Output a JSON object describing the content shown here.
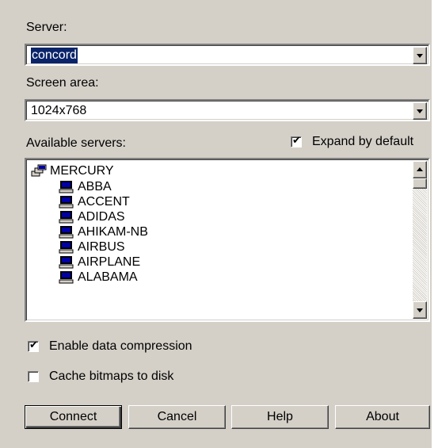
{
  "server": {
    "label": "Server:",
    "value": "concord"
  },
  "screen_area": {
    "label": "Screen area:",
    "value": "1024x768"
  },
  "available_servers": {
    "label": "Available servers:",
    "expand_by_default": {
      "label": "Expand by default",
      "checked": true
    },
    "root": {
      "label": "MERCURY",
      "icon": "network-domain-icon"
    },
    "items": [
      {
        "label": "ABBA",
        "icon": "computer-icon"
      },
      {
        "label": "ACCENT",
        "icon": "computer-icon"
      },
      {
        "label": "ADIDAS",
        "icon": "computer-icon"
      },
      {
        "label": "AHIKAM-NB",
        "icon": "computer-icon"
      },
      {
        "label": "AIRBUS",
        "icon": "computer-icon"
      },
      {
        "label": "AIRPLANE",
        "icon": "computer-icon"
      },
      {
        "label": "ALABAMA",
        "icon": "computer-icon"
      }
    ]
  },
  "options": {
    "enable_compression": {
      "label": "Enable data compression",
      "checked": true
    },
    "cache_bitmaps": {
      "label": "Cache bitmaps to disk",
      "checked": false
    }
  },
  "buttons": {
    "connect": "Connect",
    "cancel": "Cancel",
    "help": "Help",
    "about": "About"
  },
  "colors": {
    "dialog_bg": "#d4d0c8",
    "selection": "#0a246a",
    "icon_blue": "#0000a8"
  }
}
